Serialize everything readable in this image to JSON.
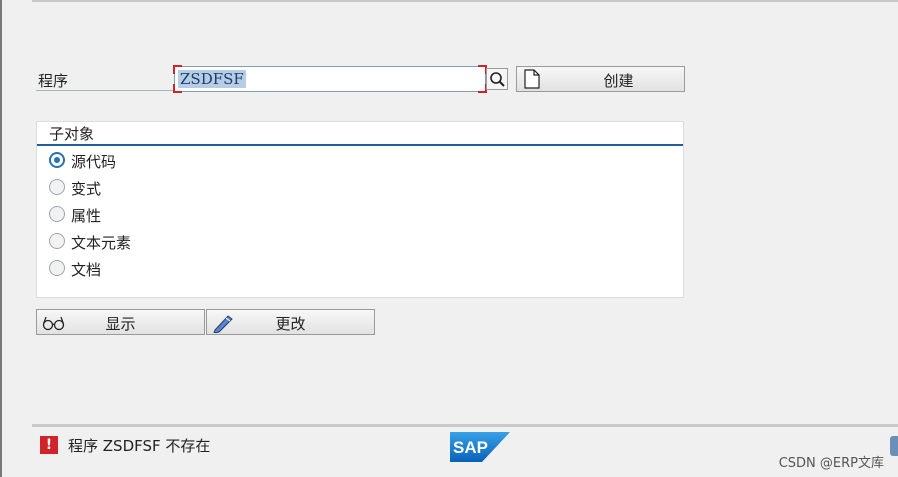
{
  "program": {
    "label": "程序",
    "value": "ZSDFSF",
    "create_label": "创建"
  },
  "subobjects": {
    "title": "子对象",
    "options": [
      {
        "label": "源代码",
        "selected": true
      },
      {
        "label": "变式",
        "selected": false
      },
      {
        "label": "属性",
        "selected": false
      },
      {
        "label": "文本元素",
        "selected": false
      },
      {
        "label": "文档",
        "selected": false
      }
    ]
  },
  "actions": {
    "display_label": "显示",
    "change_label": "更改"
  },
  "status": {
    "type": "error",
    "icon": "exclamation-icon",
    "message": "程序 ZSDFSF 不存在"
  },
  "logo": "SAP",
  "watermark": "CSDN @ERP文库",
  "colors": {
    "accent": "#1f5f9e",
    "error": "#d2232a",
    "selection": "#b7cde3"
  }
}
